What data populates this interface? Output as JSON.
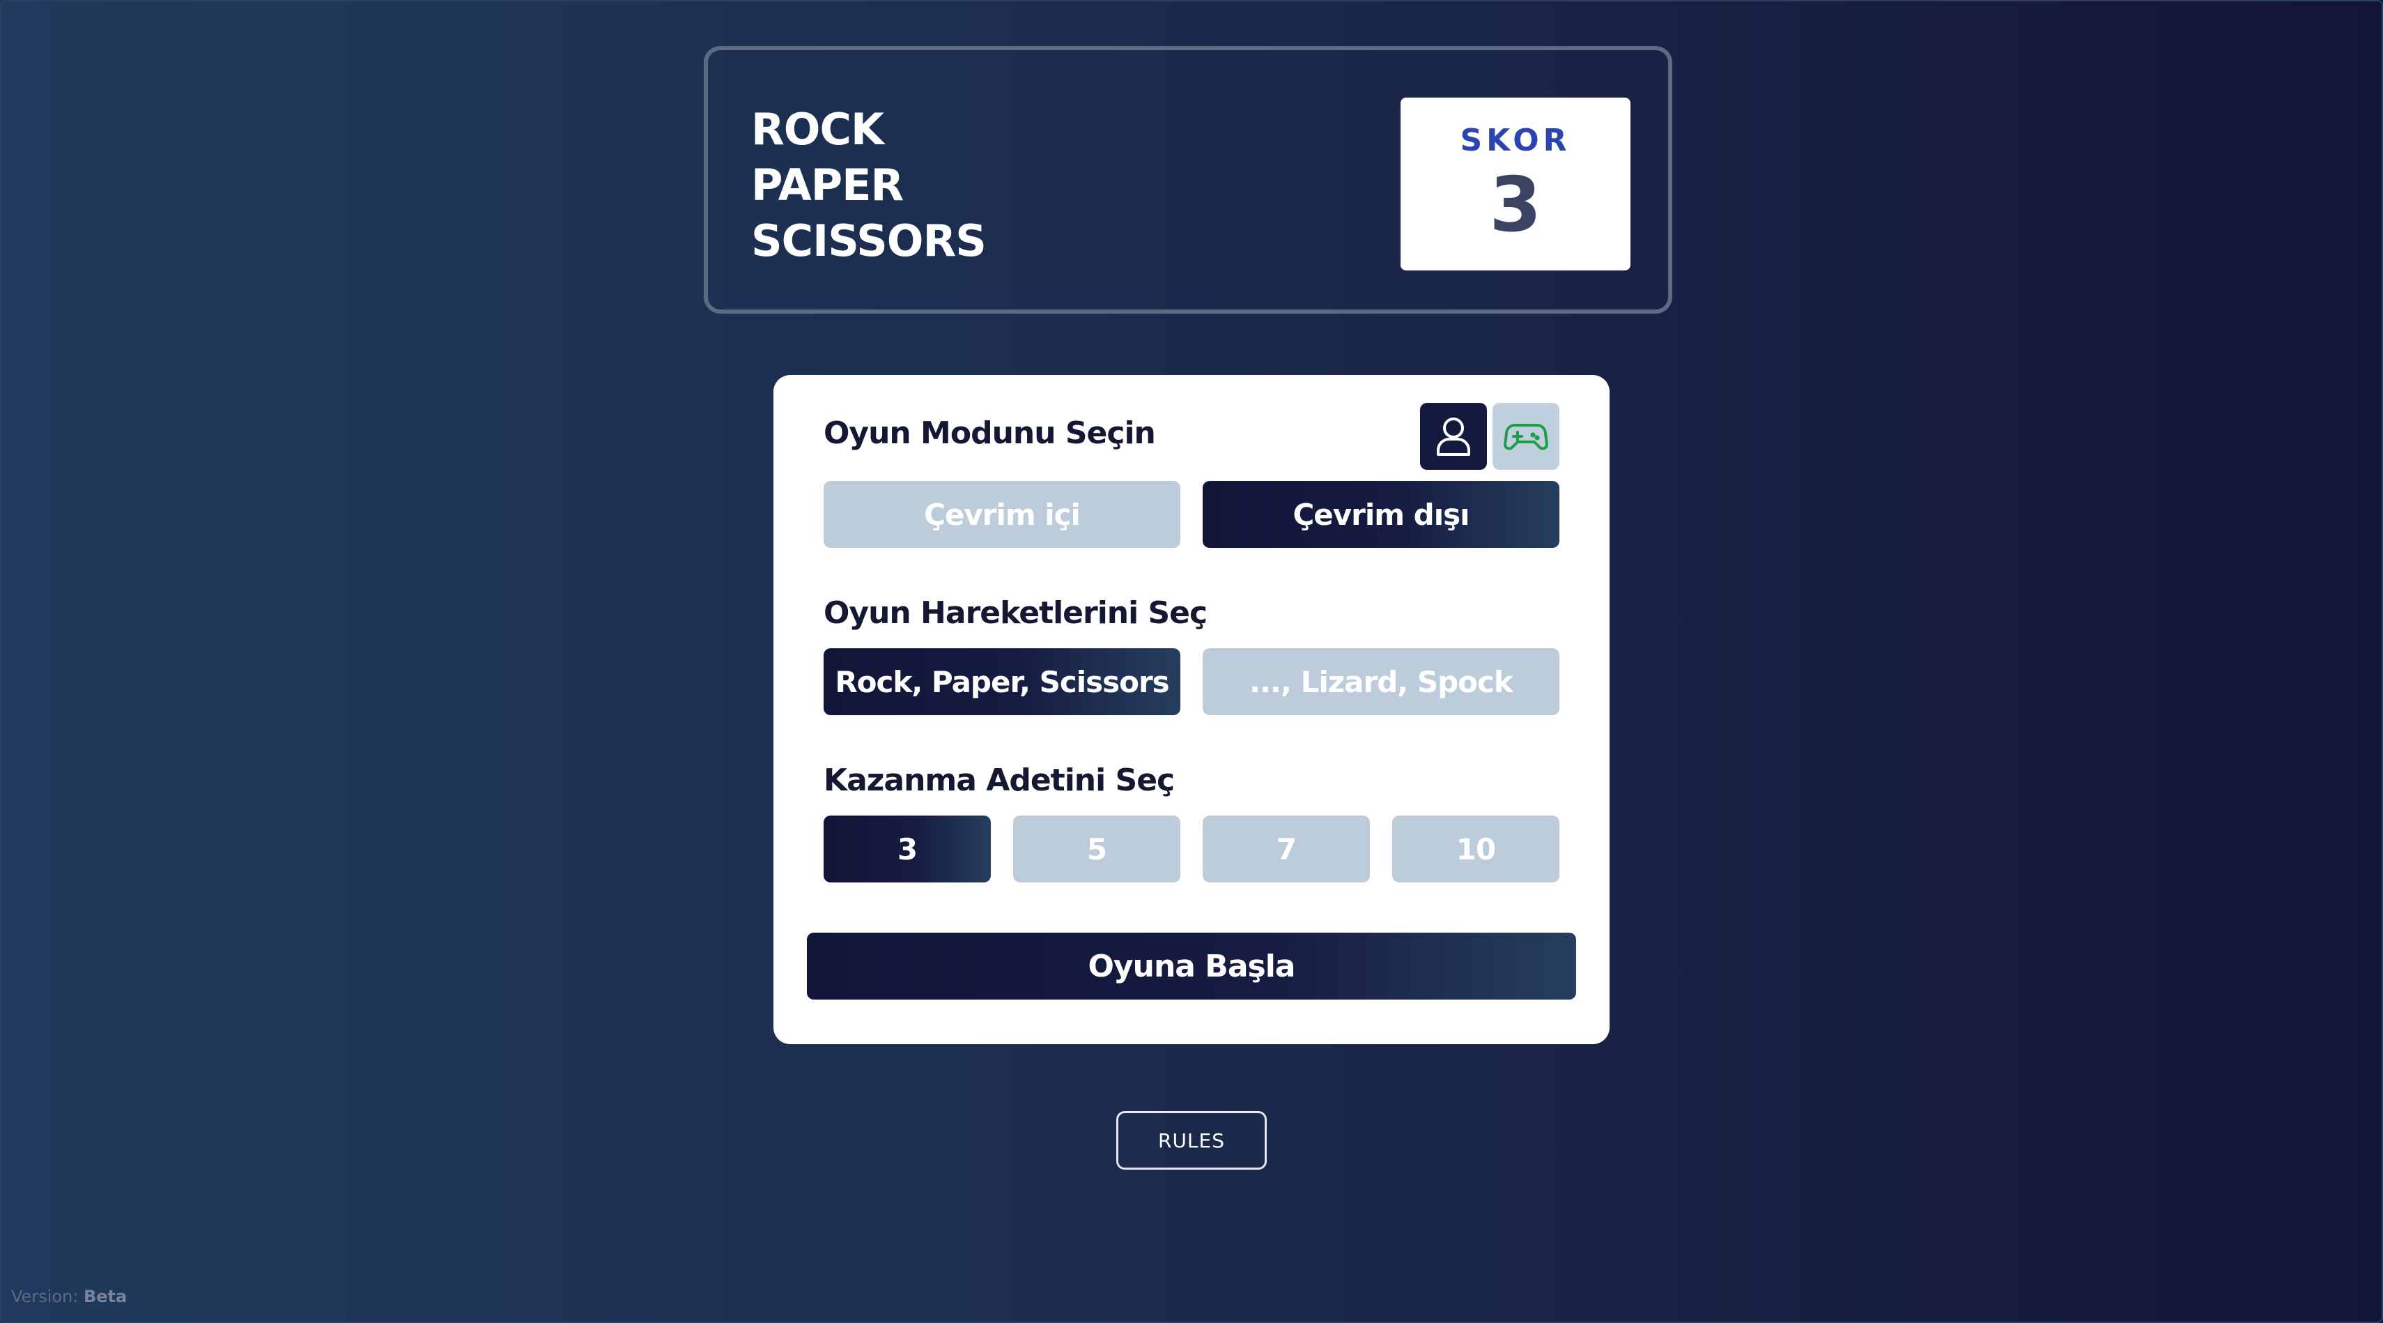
{
  "header": {
    "title_lines": [
      "ROCK",
      "PAPER",
      "SCISSORS"
    ],
    "score_label": "SKOR",
    "score_value": "3"
  },
  "settings": {
    "mode": {
      "label": "Oyun Modunu Seçin",
      "online_label": "Çevrim içi",
      "offline_label": "Çevrim dışı",
      "selected": "Çevrim dışı",
      "icons": {
        "player": "user-icon",
        "computer": "gamepad-icon"
      }
    },
    "moves": {
      "label": "Oyun Hareketlerini Seç",
      "classic_label": "Rock, Paper, Scissors",
      "extended_label": "..., Lizard, Spock",
      "selected": "Rock, Paper, Scissors"
    },
    "wins": {
      "label": "Kazanma Adetini Seç",
      "options": [
        "3",
        "5",
        "7",
        "10"
      ],
      "selected": "3"
    },
    "start_label": "Oyuna Başla"
  },
  "rules_label": "RULES",
  "version": {
    "prefix": "Version:",
    "value": "Beta"
  },
  "colors": {
    "active_button": "#141a3d",
    "inactive_button": "#bcccdb",
    "score_label": "#2a45b0",
    "gamepad_icon": "#1f9e4a"
  }
}
